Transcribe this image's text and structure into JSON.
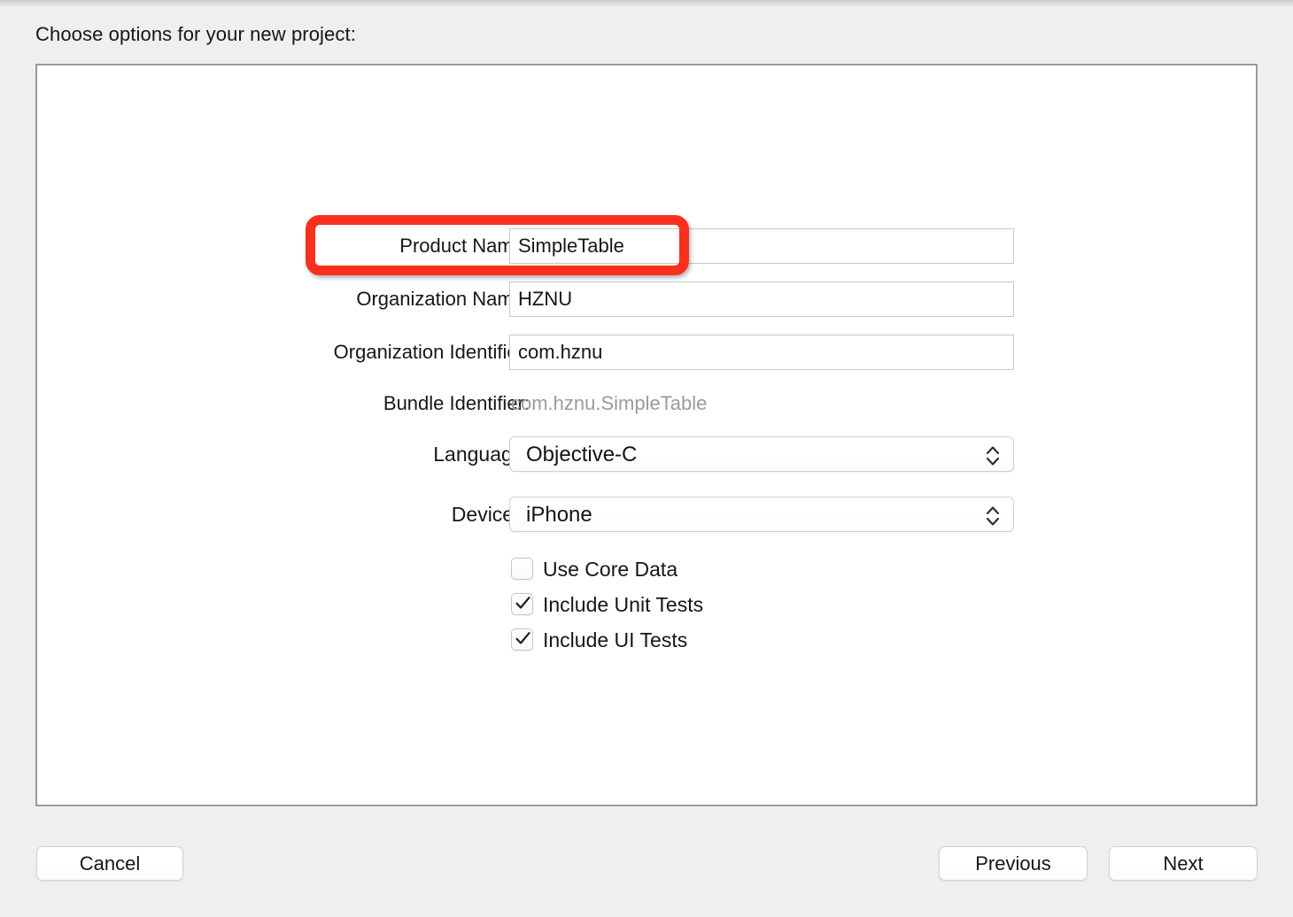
{
  "window": {
    "title": "Choose options for your new project:"
  },
  "form": {
    "fields": [
      {
        "label": "Product Name:",
        "value": "SimpleTable",
        "type": "text"
      },
      {
        "label": "Organization Name:",
        "value": "HZNU",
        "type": "text"
      },
      {
        "label": "Organization Identifier:",
        "value": "com.hznu",
        "type": "text"
      },
      {
        "label": "Bundle Identifier:",
        "value": "com.hznu.SimpleTable",
        "type": "static"
      }
    ],
    "selects": [
      {
        "label": "Language:",
        "value": "Objective-C",
        "icon": "chevron-up-down-icon"
      },
      {
        "label": "Devices:",
        "value": "iPhone",
        "icon": "chevron-up-down-icon"
      }
    ],
    "checkboxes": [
      {
        "label": "Use Core Data",
        "checked": false
      },
      {
        "label": "Include Unit Tests",
        "checked": true
      },
      {
        "label": "Include UI Tests",
        "checked": true
      }
    ]
  },
  "footer": {
    "cancel_label": "Cancel",
    "previous_label": "Previous",
    "next_label": "Next"
  },
  "annotation": {
    "name": "product-name-highlight",
    "color": "#f9301c"
  }
}
